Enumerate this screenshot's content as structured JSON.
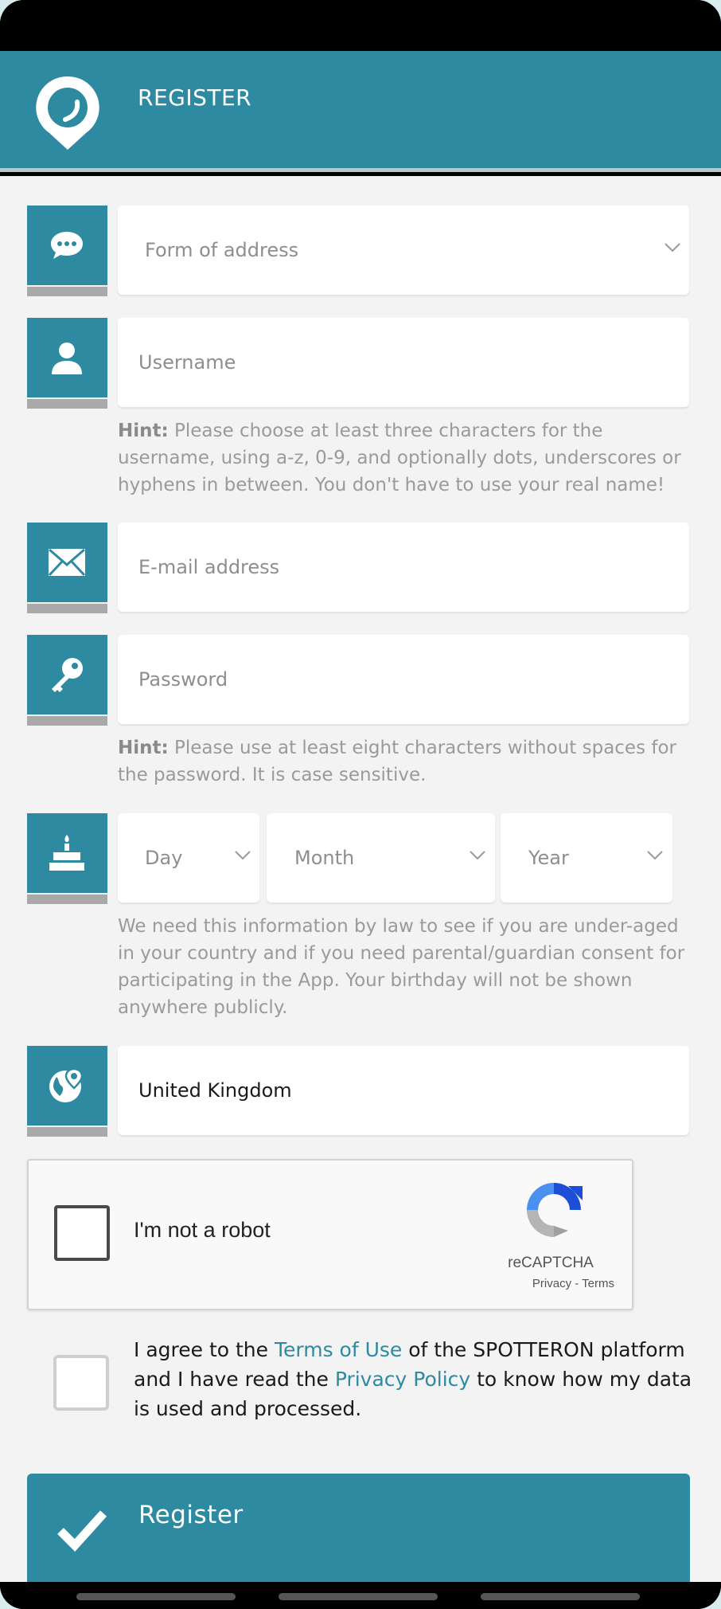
{
  "header": {
    "title": "REGISTER"
  },
  "form": {
    "address_placeholder": "Form of address",
    "username_placeholder": "Username",
    "username_hint_label": "Hint:",
    "username_hint_text": " Please choose at least three characters for the username, using a-z, 0-9, and optionally dots, underscores or hyphens in between. You don't have to use your real name!",
    "email_placeholder": "E-mail address",
    "password_placeholder": "Password",
    "password_hint_label": "Hint:",
    "password_hint_text": " Please use at least eight characters without spaces for the password. It is case sensitive.",
    "day_placeholder": "Day",
    "month_placeholder": "Month",
    "year_placeholder": "Year",
    "birthday_note": "We need this information by law to see if you are under-aged in your country and if you need parental/guardian consent for participating in the App. Your birthday will not be shown anywhere publicly.",
    "country_value": "United Kingdom"
  },
  "captcha": {
    "label": "I'm not a robot",
    "brand": "reCAPTCHA",
    "privacy": "Privacy",
    "separator": " - ",
    "terms": "Terms"
  },
  "agreement": {
    "part1": "I agree to the ",
    "terms_link": "Terms of Use",
    "part2": " of the SPOTTERON platform and I have read the ",
    "privacy_link": "Privacy Policy",
    "part3": " to know how my data is used and processed."
  },
  "register_button": {
    "label": "Register"
  },
  "colors": {
    "accent": "#2e8aa1",
    "background": "#f3f3f3",
    "hint": "#9a9a9a"
  }
}
